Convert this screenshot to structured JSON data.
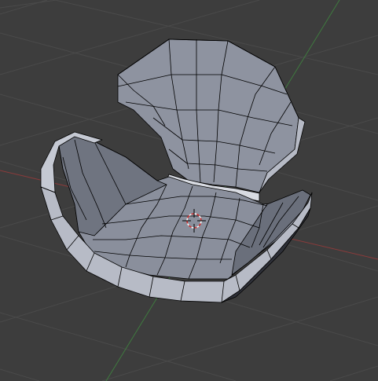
{
  "viewport": {
    "background_color": "#3d3d3d",
    "grid_color": "#4a4a4a",
    "x_axis_color": "#8a3b3b",
    "y_axis_color": "#3f7a3f",
    "mesh_light_color": "#bcc0cb",
    "mesh_mid_color": "#9499a6",
    "mesh_dark_color": "#60646f",
    "edge_color": "#000000"
  },
  "object": {
    "type": "chair-mesh",
    "origin_marker": "3d-cursor-icon"
  }
}
